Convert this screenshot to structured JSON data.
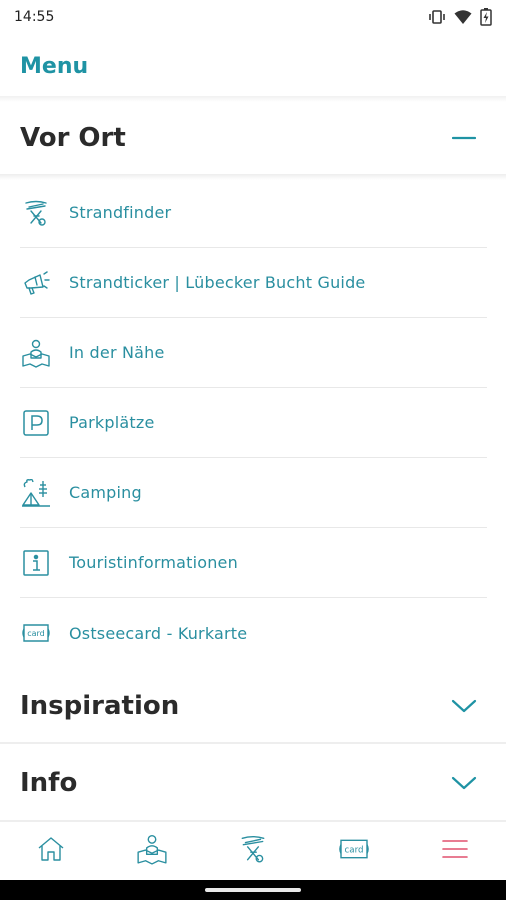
{
  "status_bar": {
    "time": "14:55",
    "icons": [
      "vibrate-icon",
      "wifi-icon",
      "battery-charging-icon"
    ]
  },
  "header": {
    "title": "Menu"
  },
  "sections": {
    "vor_ort": {
      "title": "Vor Ort",
      "state": "expanded",
      "toggle_icon": "minus-icon",
      "items": [
        {
          "label": "Strandfinder",
          "icon": "beach-chair-icon"
        },
        {
          "label": "Strandticker | Lübecker Bucht Guide",
          "icon": "megaphone-icon"
        },
        {
          "label": "In der Nähe",
          "icon": "person-map-icon"
        },
        {
          "label": "Parkplätze",
          "icon": "parking-icon"
        },
        {
          "label": "Camping",
          "icon": "camping-tent-icon"
        },
        {
          "label": "Touristinformationen",
          "icon": "info-icon"
        },
        {
          "label": "Ostseecard - Kurkarte",
          "icon": "card-icon"
        }
      ]
    },
    "inspiration": {
      "title": "Inspiration",
      "state": "collapsed",
      "toggle_icon": "chevron-down-icon"
    },
    "info": {
      "title": "Info",
      "state": "collapsed",
      "toggle_icon": "chevron-down-icon"
    }
  },
  "bottom_nav": {
    "items": [
      {
        "icon": "home-icon",
        "active": false
      },
      {
        "icon": "person-map-icon",
        "active": false
      },
      {
        "icon": "beach-chair-icon",
        "active": false
      },
      {
        "icon": "card-icon",
        "active": false
      },
      {
        "icon": "hamburger-menu-icon",
        "active": true
      }
    ]
  },
  "colors": {
    "accent": "#1f93a4",
    "active_nav": "#e0506e",
    "heading": "#2b2b2b"
  }
}
